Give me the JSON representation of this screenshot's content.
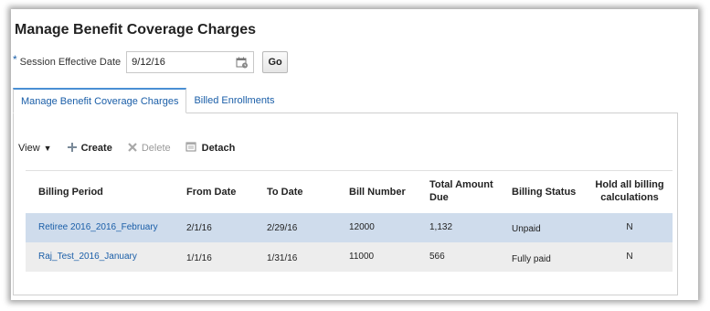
{
  "page": {
    "title": "Manage Benefit Coverage Charges"
  },
  "session": {
    "required_mark": "*",
    "label": "Session Effective Date",
    "value": "9/12/16",
    "go_label": "Go",
    "calendar_icon": "calendar-icon"
  },
  "tabs": [
    {
      "label": "Manage Benefit Coverage Charges",
      "active": true
    },
    {
      "label": "Billed Enrollments",
      "active": false
    }
  ],
  "toolbar": {
    "view_label": "View",
    "view_arrow": "▼",
    "create_label": "Create",
    "delete_label": "Delete",
    "detach_label": "Detach"
  },
  "table": {
    "headers": {
      "billing_period": "Billing Period",
      "from_date": "From Date",
      "to_date": "To Date",
      "bill_number": "Bill Number",
      "total_amount_1": "Total Amount",
      "total_amount_2": "Due",
      "billing_status": "Billing Status",
      "hold_1": "Hold all billing",
      "hold_2": "calculations"
    },
    "rows": [
      {
        "billing_period": "Retiree 2016_2016_February",
        "from_date": "2/1/16",
        "to_date": "2/29/16",
        "bill_number": "12000",
        "total_amount_due": "1,132",
        "billing_status": "Unpaid",
        "hold": "N"
      },
      {
        "billing_period": "Raj_Test_2016_January",
        "from_date": "1/1/16",
        "to_date": "1/31/16",
        "bill_number": "11000",
        "total_amount_due": "566",
        "billing_status": "Fully paid",
        "hold": "N"
      }
    ]
  },
  "colors": {
    "link": "#1a5ea8",
    "selected_row": "#cfdcec",
    "alt_row": "#ededed",
    "tab_accent": "#4a8fd4"
  }
}
